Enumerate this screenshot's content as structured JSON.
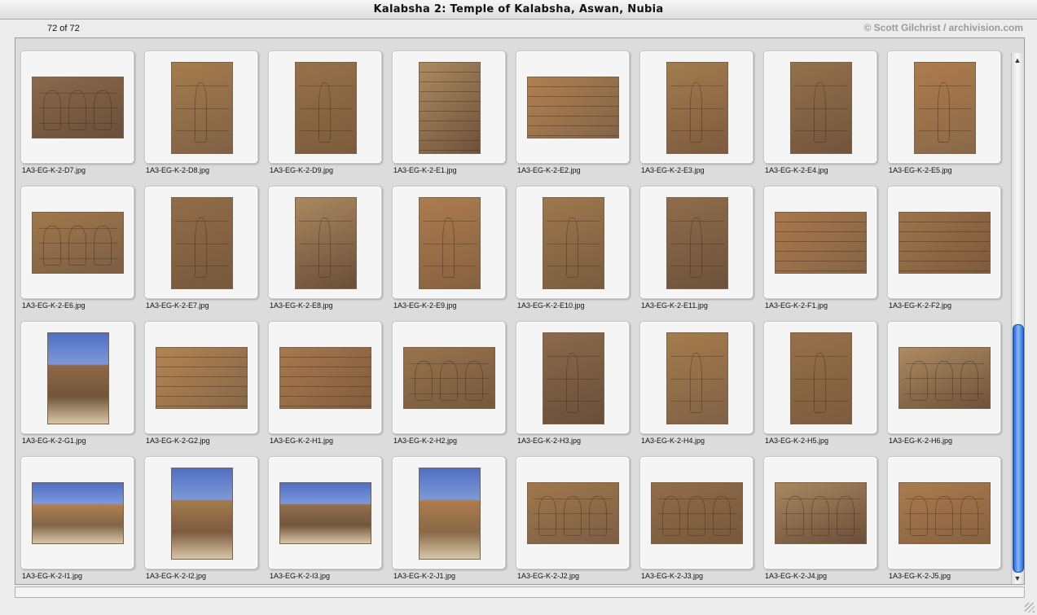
{
  "window": {
    "title": "Kalabsha 2: Temple of Kalabsha, Aswan, Nubia",
    "count": "72 of 72",
    "copyright": "© Scott Gilchrist / archivision.com"
  },
  "colors": {
    "scroll_thumb": "#2a6ee0",
    "stone": "#9c7a55",
    "sky": "#5a79c8"
  },
  "scrollbar": {
    "up_icon": "up-arrow-icon",
    "down_icon": "down-arrow-icon",
    "position_fraction": 0.55
  },
  "thumbnails": [
    {
      "name": "1A3-EG-K-2-D7.jpg",
      "orient": "land",
      "kind": "relief"
    },
    {
      "name": "1A3-EG-K-2-D8.jpg",
      "orient": "portrait",
      "kind": "relief"
    },
    {
      "name": "1A3-EG-K-2-D9.jpg",
      "orient": "portrait",
      "kind": "relief"
    },
    {
      "name": "1A3-EG-K-2-E1.jpg",
      "orient": "portrait",
      "kind": "wall"
    },
    {
      "name": "1A3-EG-K-2-E2.jpg",
      "orient": "land",
      "kind": "wall"
    },
    {
      "name": "1A3-EG-K-2-E3.jpg",
      "orient": "portrait",
      "kind": "relief"
    },
    {
      "name": "1A3-EG-K-2-E4.jpg",
      "orient": "portrait",
      "kind": "relief"
    },
    {
      "name": "1A3-EG-K-2-E5.jpg",
      "orient": "portrait",
      "kind": "relief"
    },
    {
      "name": "1A3-EG-K-2-E6.jpg",
      "orient": "land",
      "kind": "relief"
    },
    {
      "name": "1A3-EG-K-2-E7.jpg",
      "orient": "portrait",
      "kind": "relief"
    },
    {
      "name": "1A3-EG-K-2-E8.jpg",
      "orient": "portrait",
      "kind": "relief"
    },
    {
      "name": "1A3-EG-K-2-E9.jpg",
      "orient": "portrait",
      "kind": "relief"
    },
    {
      "name": "1A3-EG-K-2-E10.jpg",
      "orient": "portrait",
      "kind": "relief"
    },
    {
      "name": "1A3-EG-K-2-E11.jpg",
      "orient": "portrait",
      "kind": "relief"
    },
    {
      "name": "1A3-EG-K-2-F1.jpg",
      "orient": "land",
      "kind": "wall"
    },
    {
      "name": "1A3-EG-K-2-F2.jpg",
      "orient": "land",
      "kind": "wall"
    },
    {
      "name": "1A3-EG-K-2-G1.jpg",
      "orient": "portrait",
      "kind": "sky"
    },
    {
      "name": "1A3-EG-K-2-G2.jpg",
      "orient": "land",
      "kind": "wall"
    },
    {
      "name": "1A3-EG-K-2-H1.jpg",
      "orient": "land",
      "kind": "wall"
    },
    {
      "name": "1A3-EG-K-2-H2.jpg",
      "orient": "land",
      "kind": "relief"
    },
    {
      "name": "1A3-EG-K-2-H3.jpg",
      "orient": "portrait",
      "kind": "relief"
    },
    {
      "name": "1A3-EG-K-2-H4.jpg",
      "orient": "portrait",
      "kind": "relief"
    },
    {
      "name": "1A3-EG-K-2-H5.jpg",
      "orient": "portrait",
      "kind": "relief"
    },
    {
      "name": "1A3-EG-K-2-H6.jpg",
      "orient": "land",
      "kind": "relief"
    },
    {
      "name": "1A3-EG-K-2-I1.jpg",
      "orient": "land",
      "kind": "sky"
    },
    {
      "name": "1A3-EG-K-2-I2.jpg",
      "orient": "portrait",
      "kind": "sky"
    },
    {
      "name": "1A3-EG-K-2-I3.jpg",
      "orient": "land",
      "kind": "sky"
    },
    {
      "name": "1A3-EG-K-2-J1.jpg",
      "orient": "portrait",
      "kind": "sky"
    },
    {
      "name": "1A3-EG-K-2-J2.jpg",
      "orient": "land",
      "kind": "relief"
    },
    {
      "name": "1A3-EG-K-2-J3.jpg",
      "orient": "land",
      "kind": "relief"
    },
    {
      "name": "1A3-EG-K-2-J4.jpg",
      "orient": "land",
      "kind": "relief"
    },
    {
      "name": "1A3-EG-K-2-J5.jpg",
      "orient": "land",
      "kind": "relief"
    }
  ]
}
